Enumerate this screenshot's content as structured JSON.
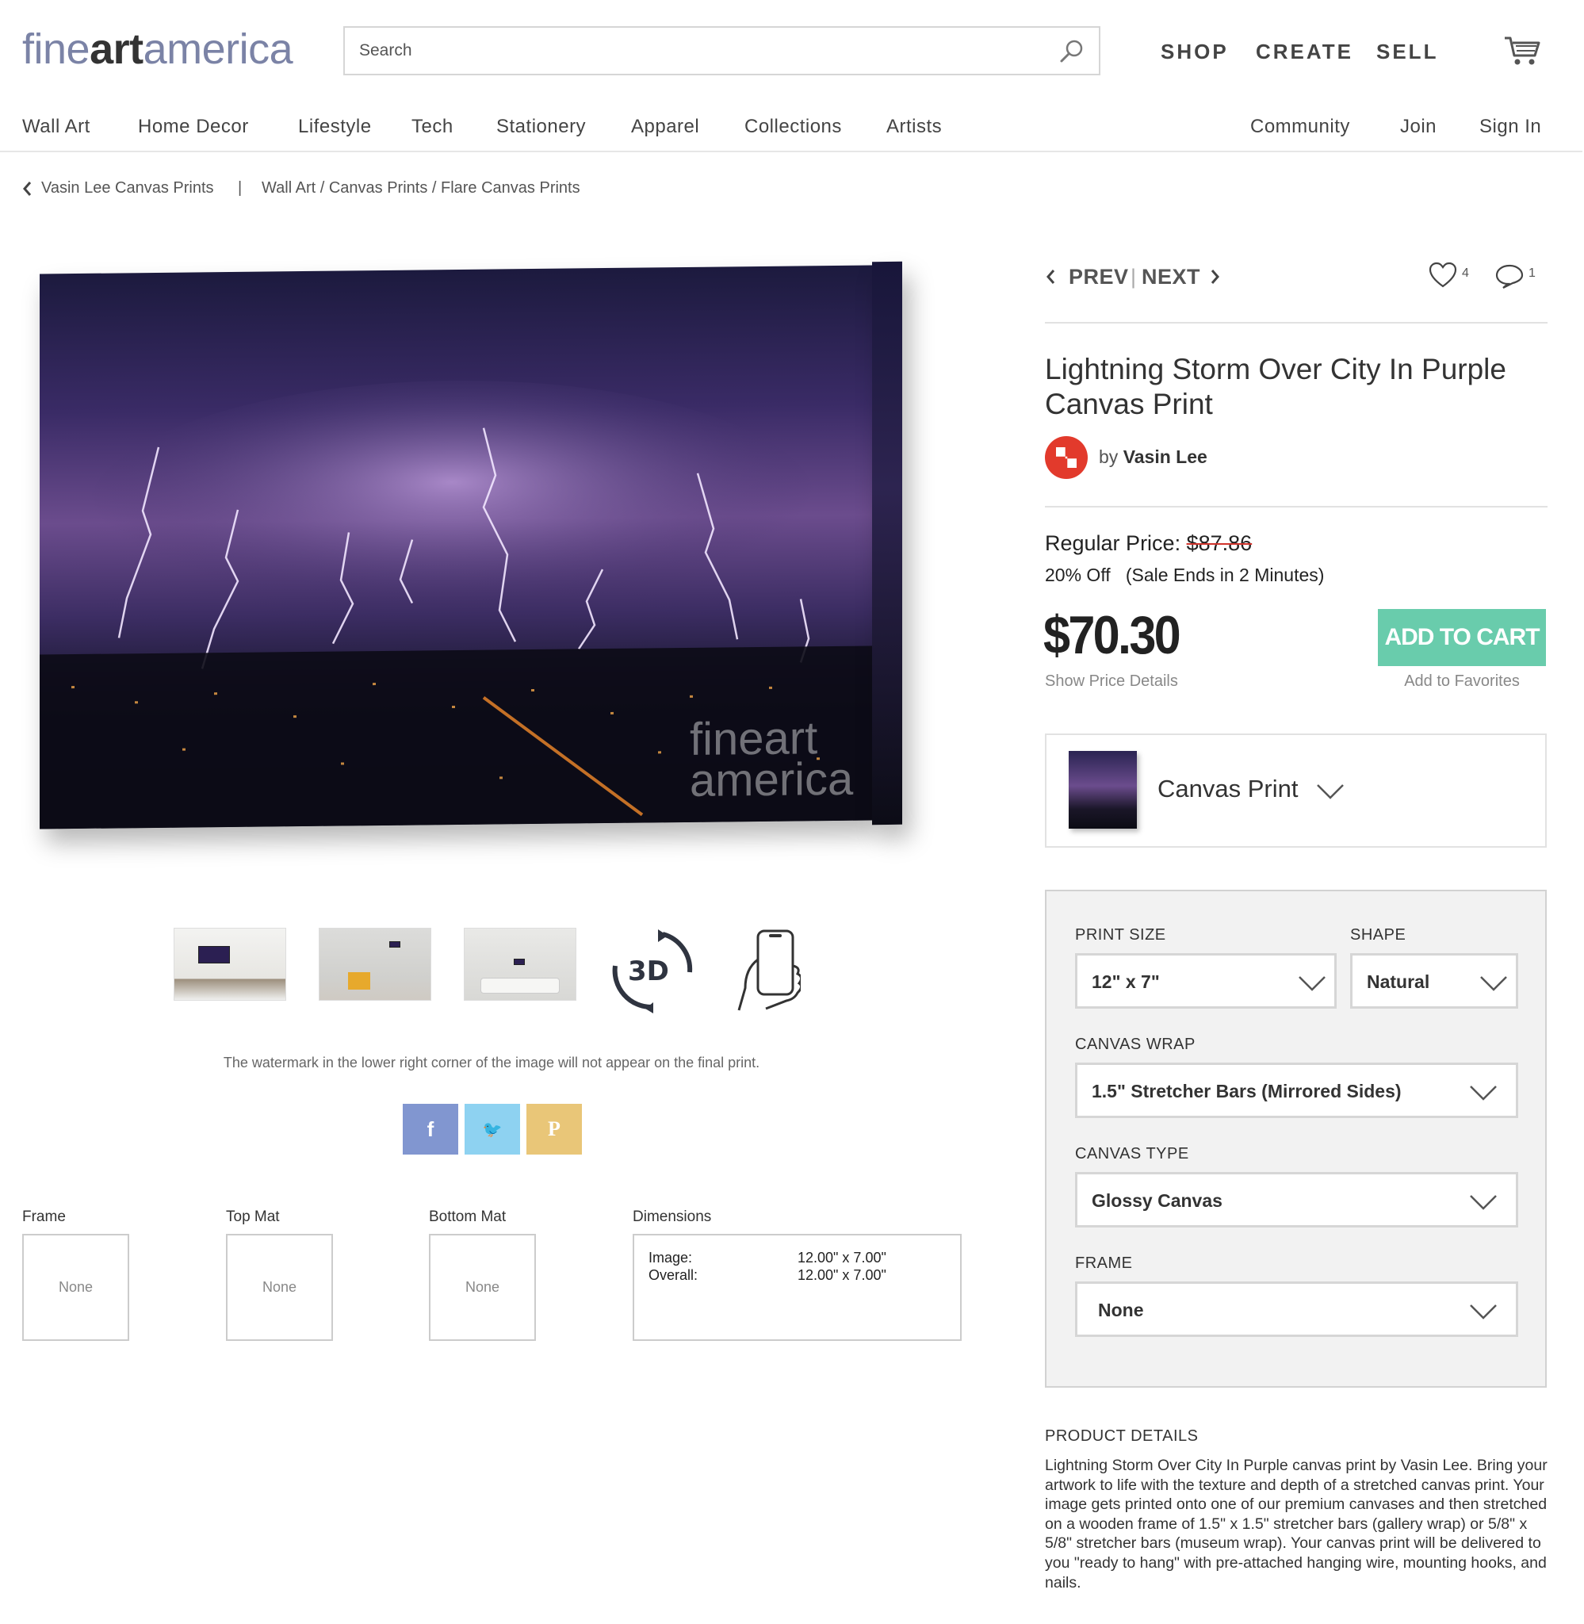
{
  "brand": {
    "logo_prefix": "fine",
    "logo_bold": "art",
    "logo_suffix": "america"
  },
  "search": {
    "placeholder": "Search"
  },
  "topnav": {
    "shop": "SHOP",
    "create": "CREATE",
    "sell": "SELL"
  },
  "catnav": [
    "Wall Art",
    "Home Decor",
    "Lifestyle",
    "Tech",
    "Stationery",
    "Apparel",
    "Collections",
    "Artists"
  ],
  "account": {
    "community": "Community",
    "join": "Join",
    "signin": "Sign In"
  },
  "breadcrumb": {
    "back": "Vasin Lee Canvas Prints",
    "separator": "|",
    "path": "Wall Art / Canvas Prints / Flare Canvas Prints"
  },
  "image": {
    "watermark_line1": "fineart",
    "watermark_line2": "america"
  },
  "watermark_note": "The watermark in the lower right corner of the image will not appear on the final print.",
  "share": {
    "facebook": "f",
    "twitter": "🐦",
    "pinterest": "P"
  },
  "options_summary": {
    "frame_label": "Frame",
    "frame_value": "None",
    "topmat_label": "Top Mat",
    "topmat_value": "None",
    "bottommat_label": "Bottom Mat",
    "bottommat_value": "None",
    "dimensions_label": "Dimensions",
    "dim_image_label": "Image:",
    "dim_image_value": "12.00\" x 7.00\"",
    "dim_overall_label": "Overall:",
    "dim_overall_value": "12.00\" x 7.00\""
  },
  "pager": {
    "prev": "PREV",
    "sep": "|",
    "next": "NEXT",
    "likes": "4",
    "comments": "1"
  },
  "product": {
    "title": "Lightning Storm Over City In Purple Canvas Print",
    "by": "by",
    "artist": "Vasin Lee",
    "regular_label": "Regular Price:",
    "regular_price": "$87.86",
    "discount": "20% Off   (Sale Ends in 2 Minutes)",
    "price": "$70.30",
    "show_price_details": "Show Price Details",
    "add_to_cart": "ADD TO CART",
    "add_to_favorites": "Add to Favorites",
    "type": "Canvas Print"
  },
  "config": {
    "print_size_label": "PRINT SIZE",
    "print_size": "12\" x 7\"",
    "shape_label": "SHAPE",
    "shape": "Natural",
    "wrap_label": "CANVAS WRAP",
    "wrap": "1.5\" Stretcher Bars (Mirrored Sides)",
    "type_label": "CANVAS TYPE",
    "canvas_type": "Glossy Canvas",
    "frame_label": "FRAME",
    "frame": "None"
  },
  "details": {
    "heading": "PRODUCT DETAILS",
    "text": "Lightning Storm Over City In Purple canvas print by Vasin Lee.   Bring your artwork to life with the texture and depth of a stretched canvas print. Your image gets printed onto one of our premium canvases and then stretched on a wooden frame of 1.5\" x 1.5\" stretcher bars (gallery wrap) or 5/8\" x 5/8\" stretcher bars (museum wrap). Your canvas print will be delivered to you \"ready to hang\" with pre-attached hanging wire, mounting hooks, and nails."
  },
  "colors": {
    "accent_button": "#69ccac",
    "logo": "#7b83a6",
    "facebook": "#8196d0",
    "twitter": "#8ed2f1",
    "pinterest": "#e9c678",
    "strike": "#d0342c"
  }
}
